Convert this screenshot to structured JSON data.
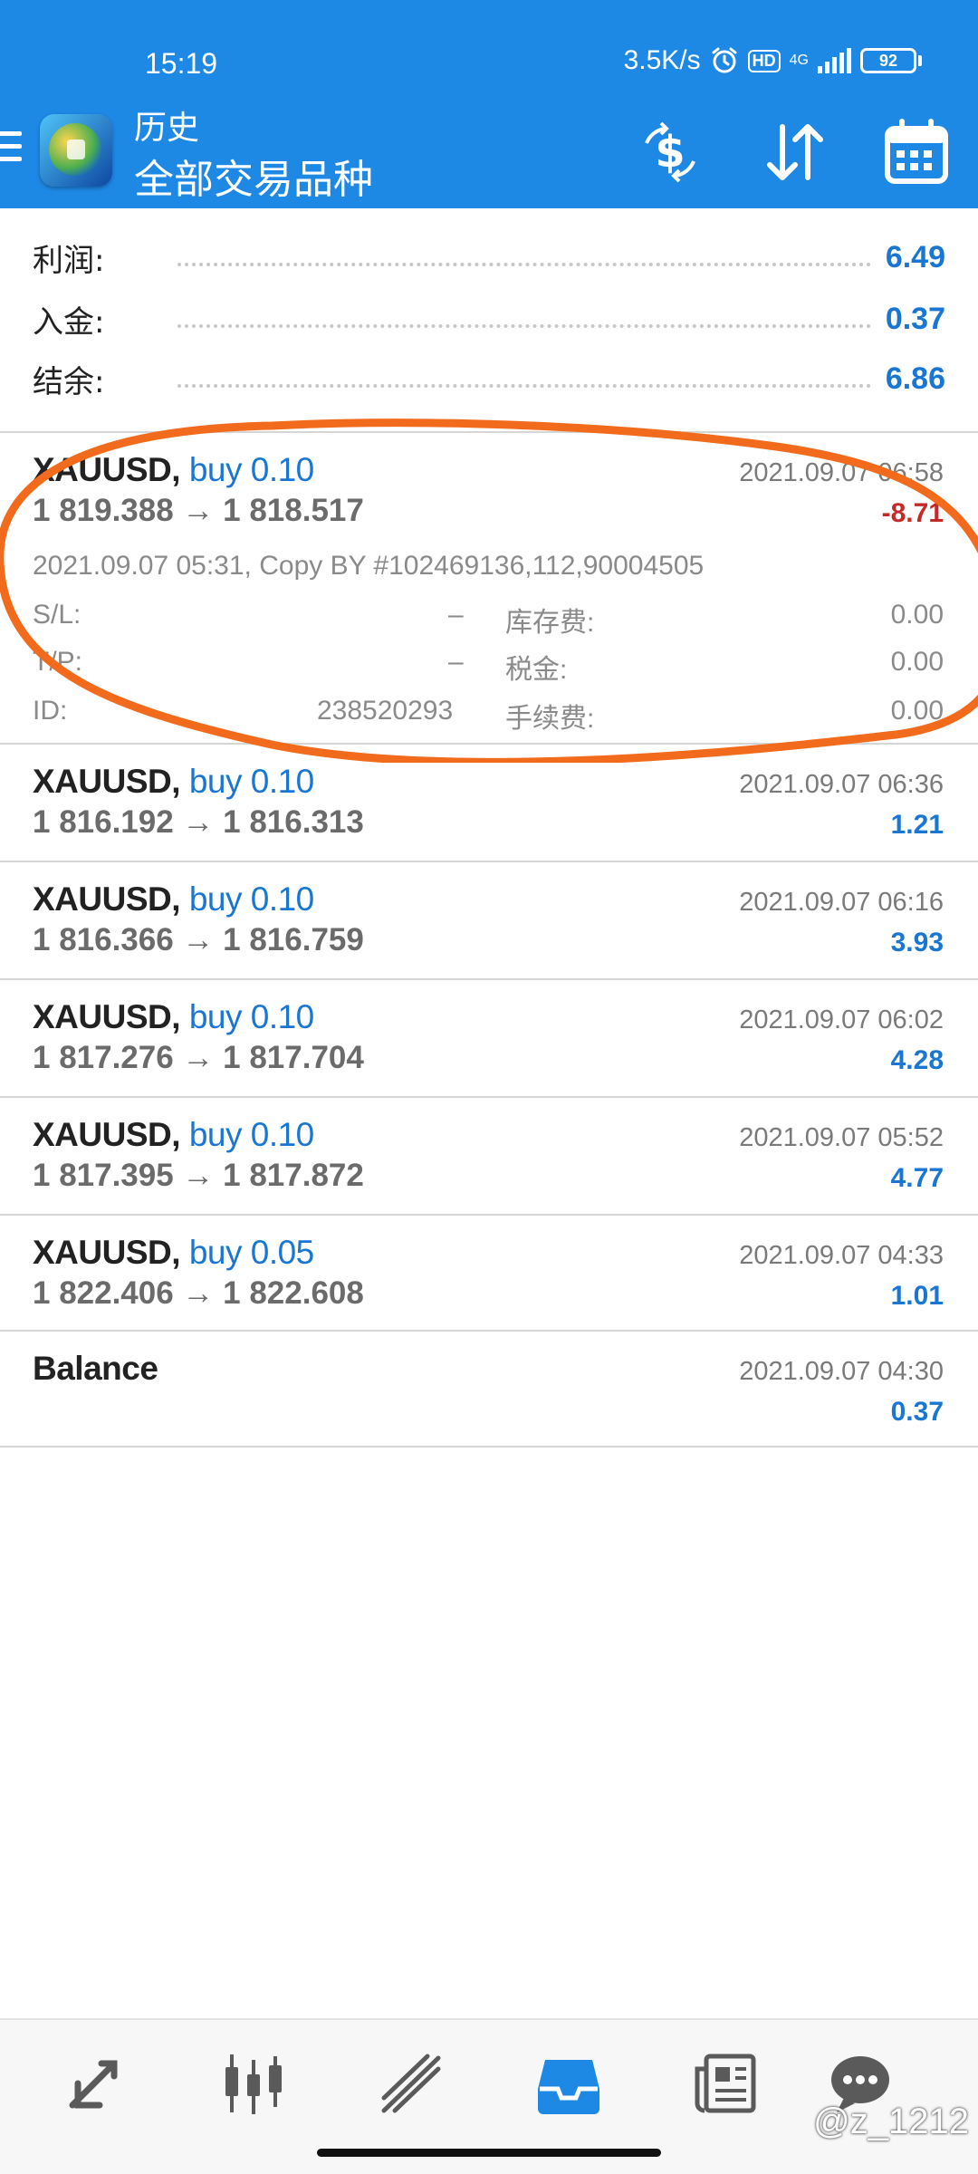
{
  "status_bar": {
    "time": "15:19",
    "net_speed": "3.5K/s",
    "hd": "HD",
    "network": "4G",
    "battery": "92"
  },
  "header": {
    "title": "历史",
    "subtitle": "全部交易品种",
    "icons": [
      "menu-icon",
      "metatrader-logo",
      "dollar-exchange-icon",
      "sort-icon",
      "calendar-icon"
    ]
  },
  "summary": {
    "profit_label": "利润:",
    "profit_value": "6.49",
    "deposit_label": "入金:",
    "deposit_value": "0.37",
    "balance_label": "结余:",
    "balance_value": "6.86"
  },
  "trades": [
    {
      "symbol": "XAUUSD,",
      "side": "buy 0.10",
      "prices": "1 819.388 → 1 818.517",
      "datetime": "2021.09.07 06:58",
      "profit": "-8.71",
      "expanded": {
        "comment": "2021.09.07 05:31, Copy BY #102469136,112,90004505",
        "sl_label": "S/L:",
        "sl_value": "–",
        "tp_label": "T/P:",
        "tp_value": "–",
        "id_label": "ID:",
        "id_value": "238520293",
        "swap_label": "库存费:",
        "swap_value": "0.00",
        "tax_label": "税金:",
        "tax_value": "0.00",
        "commission_label": "手续费:",
        "commission_value": "0.00"
      }
    },
    {
      "symbol": "XAUUSD,",
      "side": "buy 0.10",
      "prices": "1 816.192 → 1 816.313",
      "datetime": "2021.09.07 06:36",
      "profit": "1.21"
    },
    {
      "symbol": "XAUUSD,",
      "side": "buy 0.10",
      "prices": "1 816.366 → 1 816.759",
      "datetime": "2021.09.07 06:16",
      "profit": "3.93"
    },
    {
      "symbol": "XAUUSD,",
      "side": "buy 0.10",
      "prices": "1 817.276 → 1 817.704",
      "datetime": "2021.09.07 06:02",
      "profit": "4.28"
    },
    {
      "symbol": "XAUUSD,",
      "side": "buy 0.10",
      "prices": "1 817.395 → 1 817.872",
      "datetime": "2021.09.07 05:52",
      "profit": "4.77"
    },
    {
      "symbol": "XAUUSD,",
      "side": "buy 0.05",
      "prices": "1 822.406 → 1 822.608",
      "datetime": "2021.09.07 04:33",
      "profit": "1.01"
    }
  ],
  "balance_op": {
    "label": "Balance",
    "datetime": "2021.09.07 04:30",
    "amount": "0.37"
  },
  "bottom_nav": {
    "items": [
      "quotes-icon",
      "chart-icon",
      "trade-icon",
      "history-icon",
      "news-icon",
      "chat-icon"
    ],
    "active": "history-icon"
  },
  "watermark": "@z_1212",
  "colors": {
    "header_bg": "#1e88e5",
    "positive": "#1976d2",
    "negative": "#c62828",
    "annotation": "#f26b1d"
  }
}
